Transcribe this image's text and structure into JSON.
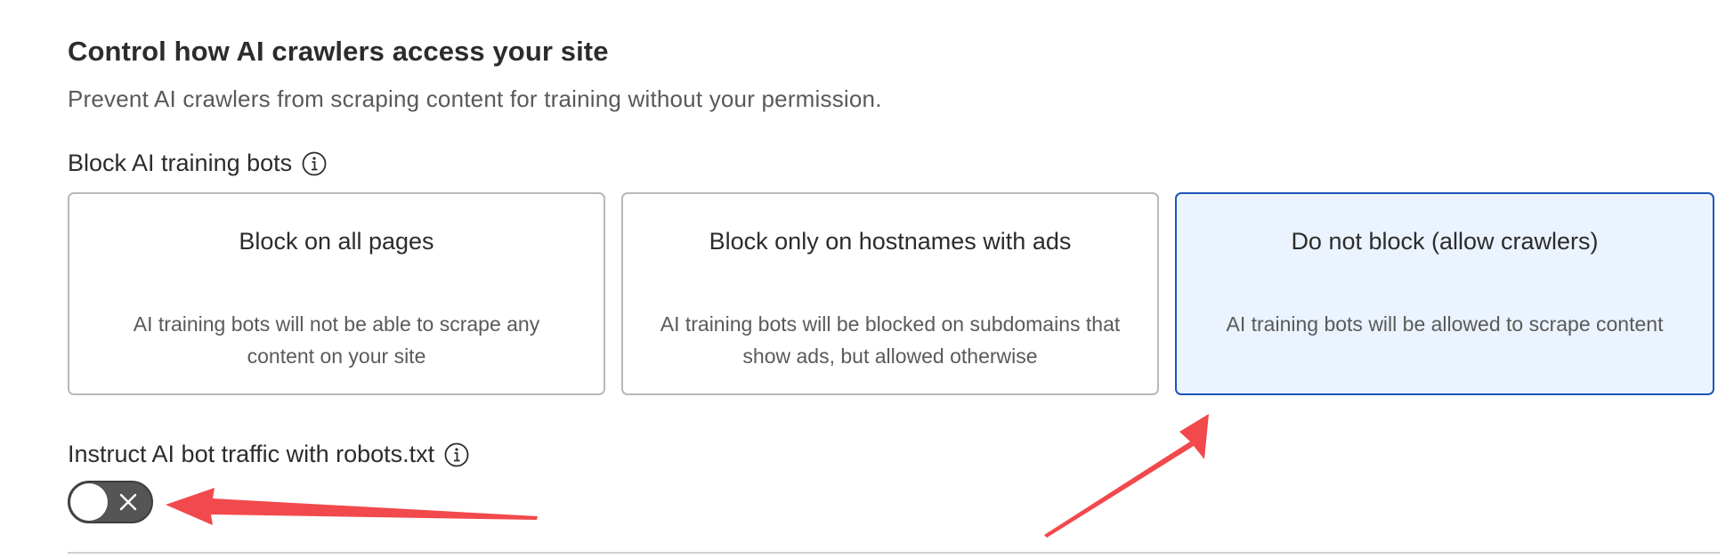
{
  "header": {
    "title": "Control how AI crawlers access your site",
    "subtitle": "Prevent AI crawlers from scraping content for training without your permission."
  },
  "block_bots": {
    "label": "Block AI training bots",
    "info_icon": "info-circle-icon",
    "selected_option": "Do not block (allow crawlers)",
    "options": [
      {
        "title": "Block on all pages",
        "description": "AI training bots will not be able to scrape any content on your site",
        "selected": false
      },
      {
        "title": "Block only on hostnames with ads",
        "description": "AI training bots will be blocked on subdomains that show ads, but allowed otherwise",
        "selected": false
      },
      {
        "title": "Do not block (allow crawlers)",
        "description": "AI training bots will be allowed to scrape content",
        "selected": true
      }
    ]
  },
  "robots_txt": {
    "label": "Instruct AI bot traffic with robots.txt",
    "info_icon": "info-circle-icon",
    "toggle_on": false,
    "toggle_icon": "close-icon"
  },
  "colors": {
    "selected_border": "#1d55b8",
    "selected_background": "#ebf3fe",
    "toggle_off": "#555555",
    "annotation_arrow": "#f2494c"
  }
}
